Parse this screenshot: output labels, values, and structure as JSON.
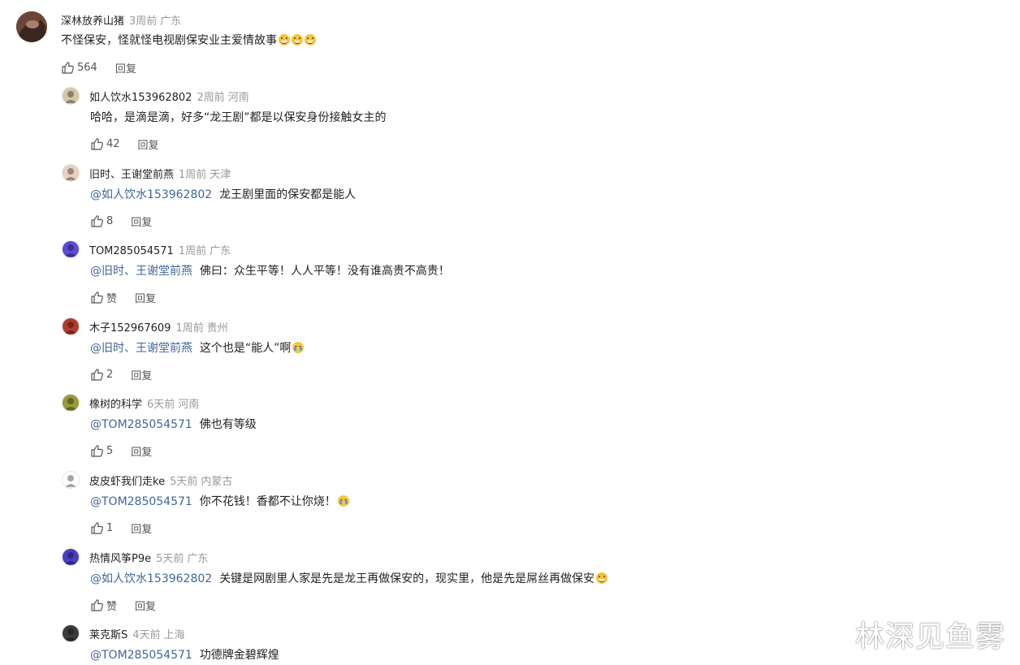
{
  "top_comment": {
    "username": "深林放养山猪",
    "time": "3周前",
    "location": "广东",
    "text": "不怪保安，怪就怪电视剧保安业主爱情故事",
    "likes": "564",
    "reply_label": "回复"
  },
  "replies": [
    {
      "username": "如人饮水153962802",
      "time": "2周前",
      "location": "河南",
      "mention": "",
      "text": "哈哈，是滴是滴，好多“龙王剧”都是以保安身份接触女主的",
      "likes": "42",
      "reply_label": "回复"
    },
    {
      "username": "旧时、王谢堂前燕",
      "time": "1周前",
      "location": "天津",
      "mention": "@如人饮水153962802",
      "text": "龙王剧里面的保安都是能人",
      "likes": "8",
      "reply_label": "回复"
    },
    {
      "username": "TOM285054571",
      "time": "1周前",
      "location": "广东",
      "mention": "@旧时、王谢堂前燕",
      "text": "佛曰：众生平等！人人平等！没有谁高贵不高贵！",
      "likes": "赞",
      "reply_label": "回复"
    },
    {
      "username": "木子152967609",
      "time": "1周前",
      "location": "贵州",
      "mention": "@旧时、王谢堂前燕",
      "text": "这个也是“能人”啊",
      "likes": "2",
      "reply_label": "回复"
    },
    {
      "username": "橡树的科学",
      "time": "6天前",
      "location": "河南",
      "mention": "@TOM285054571",
      "text": "佛也有等级",
      "likes": "5",
      "reply_label": "回复"
    },
    {
      "username": "皮皮虾我们走ke",
      "time": "5天前",
      "location": "内蒙古",
      "mention": "@TOM285054571",
      "text": "你不花钱！香都不让你烧！",
      "likes": "1",
      "reply_label": "回复"
    },
    {
      "username": "热情风筝P9e",
      "time": "5天前",
      "location": "广东",
      "mention": "@如人饮水153962802",
      "text": "关键是网剧里人家是先是龙王再做保安的，现实里，他是先是屌丝再做保安",
      "likes": "赞",
      "reply_label": "回复"
    },
    {
      "username": "莱克斯S",
      "time": "4天前",
      "location": "上海",
      "mention": "@TOM285054571",
      "text": "功德牌金碧辉煌",
      "likes": "",
      "reply_label": ""
    }
  ],
  "watermark": "林深见鱼雾",
  "colors": {
    "mention": "#406599",
    "meta": "#999999",
    "text": "#222222"
  }
}
